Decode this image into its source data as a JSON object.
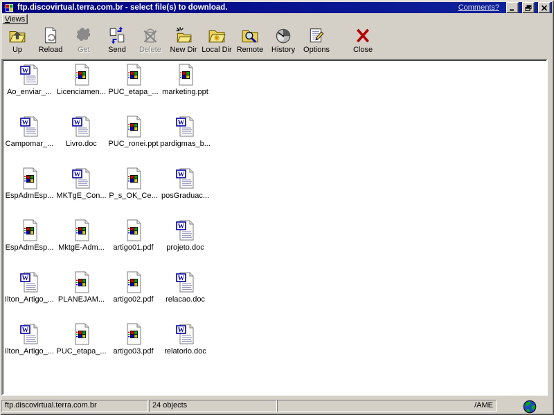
{
  "window": {
    "title": "ftp.discovirtual.terra.com.br - select file(s) to download.",
    "comments_link": "Comments?"
  },
  "menubar": {
    "views_label": "Views"
  },
  "toolbar": {
    "items": [
      {
        "label": "Up",
        "icon": "tb-up",
        "enabled": true
      },
      {
        "label": "Reload",
        "icon": "tb-reload",
        "enabled": true
      },
      {
        "label": "Get",
        "icon": "tb-get",
        "enabled": false
      },
      {
        "label": "Send",
        "icon": "tb-send",
        "enabled": true
      },
      {
        "label": "Delete",
        "icon": "tb-delete",
        "enabled": false
      },
      {
        "label": "New Dir",
        "icon": "tb-newdir",
        "enabled": true
      },
      {
        "label": "Local Dir",
        "icon": "tb-localdir",
        "enabled": true
      },
      {
        "label": "Remote",
        "icon": "tb-remote",
        "enabled": true
      },
      {
        "label": "History",
        "icon": "tb-history",
        "enabled": true
      },
      {
        "label": "Options",
        "icon": "tb-options",
        "enabled": true
      },
      {
        "label": "Close",
        "icon": "tb-close",
        "enabled": true
      }
    ]
  },
  "files": [
    {
      "name": "Ao_enviar_...",
      "icon": "word"
    },
    {
      "name": "Licenciamen...",
      "icon": "generic"
    },
    {
      "name": "PUC_etapa_...",
      "icon": "generic"
    },
    {
      "name": "marketing.ppt",
      "icon": "generic"
    },
    {
      "name": "Campomar_...",
      "icon": "word"
    },
    {
      "name": "Livro.doc",
      "icon": "word"
    },
    {
      "name": "PUC_ronei.ppt",
      "icon": "generic"
    },
    {
      "name": "pardigmas_b...",
      "icon": "word"
    },
    {
      "name": "EspAdmEsp...",
      "icon": "generic"
    },
    {
      "name": "MKTgE_Con...",
      "icon": "word"
    },
    {
      "name": "P_s_OK_Ce...",
      "icon": "generic"
    },
    {
      "name": "posGraduac...",
      "icon": "word"
    },
    {
      "name": "EspAdmEsp...",
      "icon": "generic"
    },
    {
      "name": "MktgE-Adm...",
      "icon": "generic"
    },
    {
      "name": "artigo01.pdf",
      "icon": "generic"
    },
    {
      "name": "projeto.doc",
      "icon": "word"
    },
    {
      "name": "Ilton_Artigo_...",
      "icon": "word"
    },
    {
      "name": "PLANEJAM...",
      "icon": "generic"
    },
    {
      "name": "artigo02.pdf",
      "icon": "generic"
    },
    {
      "name": "relacao.doc",
      "icon": "word"
    },
    {
      "name": "Ilton_Artigo_...",
      "icon": "word"
    },
    {
      "name": "PUC_etapa_...",
      "icon": "generic"
    },
    {
      "name": "artigo03.pdf",
      "icon": "generic"
    },
    {
      "name": "relatorio.doc",
      "icon": "word"
    }
  ],
  "statusbar": {
    "host": "ftp.discovirtual.terra.com.br",
    "objects": "24 objects",
    "path": "/AME"
  },
  "colors": {
    "titlebar_blue": "#000080",
    "chrome_gray": "#d4d0c8",
    "listing_bg": "#ffffff",
    "disabled_text": "#848484",
    "close_red": "#b40000",
    "folder_yellow": "#e8d05a"
  }
}
